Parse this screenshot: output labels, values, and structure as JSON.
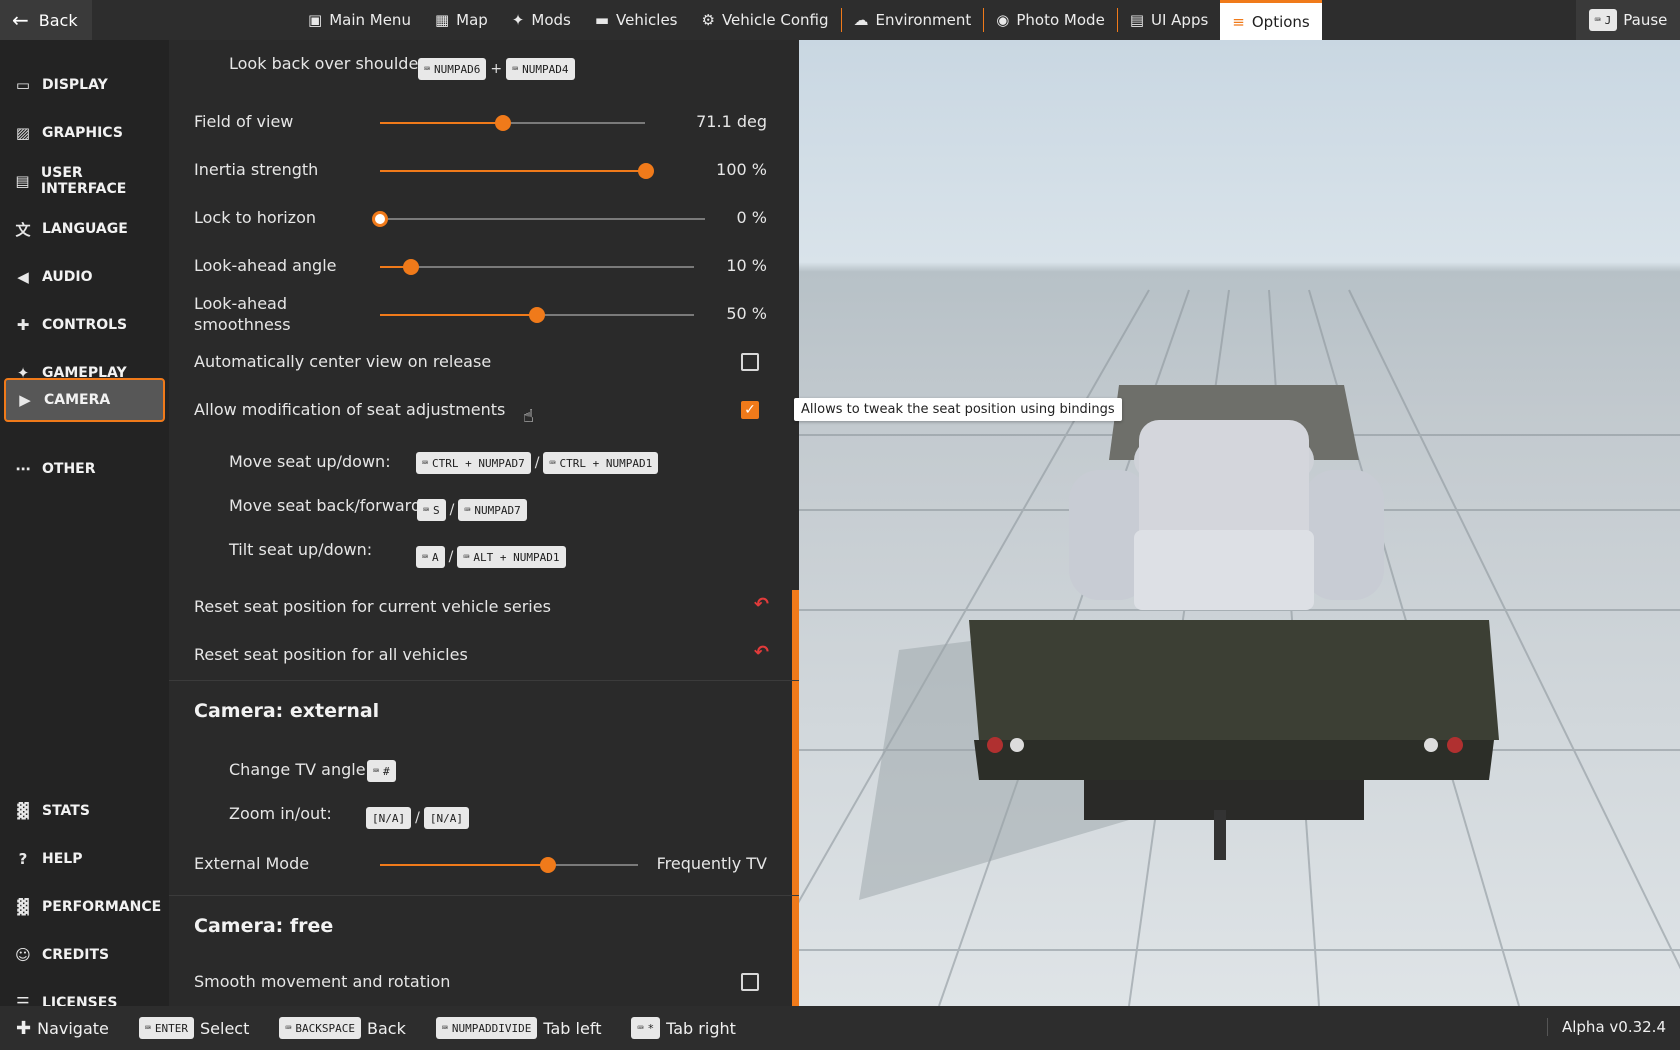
{
  "topbar": {
    "back_label": "Back",
    "tabs": [
      {
        "icon": "main-menu-icon",
        "label": "Main Menu"
      },
      {
        "icon": "map-icon",
        "label": "Map"
      },
      {
        "icon": "mods-icon",
        "label": "Mods"
      },
      {
        "icon": "car-icon",
        "label": "Vehicles"
      },
      {
        "icon": "engine-icon",
        "label": "Vehicle Config"
      },
      {
        "icon": "weather-icon",
        "label": "Environment"
      },
      {
        "icon": "camera-icon",
        "label": "Photo Mode"
      },
      {
        "icon": "apps-icon",
        "label": "UI Apps"
      },
      {
        "icon": "sliders-icon",
        "label": "Options"
      }
    ],
    "active_tab": "Options",
    "pause_key": "J",
    "pause_label": "Pause"
  },
  "sidebar": {
    "items": [
      {
        "icon": "monitor-icon",
        "label": "DISPLAY"
      },
      {
        "icon": "image-icon",
        "label": "GRAPHICS"
      },
      {
        "icon": "ui-icon",
        "label": "USER INTERFACE"
      },
      {
        "icon": "translate-icon",
        "label": "LANGUAGE"
      },
      {
        "icon": "speaker-icon",
        "label": "AUDIO"
      },
      {
        "icon": "gamepad-icon",
        "label": "CONTROLS"
      },
      {
        "icon": "puzzle-icon",
        "label": "GAMEPLAY"
      },
      {
        "icon": "video-camera-icon",
        "label": "CAMERA"
      },
      {
        "icon": "more-icon",
        "label": "OTHER"
      }
    ],
    "bottom_items": [
      {
        "icon": "bar-chart-icon",
        "label": "STATS"
      },
      {
        "icon": "help-icon",
        "label": "HELP"
      },
      {
        "icon": "performance-icon",
        "label": "PERFORMANCE"
      },
      {
        "icon": "people-icon",
        "label": "CREDITS"
      },
      {
        "icon": "license-icon",
        "label": "LICENSES"
      }
    ],
    "active": "CAMERA"
  },
  "settings": {
    "look_back": {
      "label": "Look back over shoulder:",
      "key1": "NUMPAD6",
      "joiner": "+",
      "key2": "NUMPAD4"
    },
    "fov": {
      "label": "Field of view",
      "value": "71.1 deg",
      "fraction": 0.466
    },
    "inertia": {
      "label": "Inertia strength",
      "value": "100 %",
      "fraction": 1.0
    },
    "lock_horizon": {
      "label": "Lock to horizon",
      "value": "0 %",
      "fraction": 0.0
    },
    "look_ahead_angle": {
      "label": "Look-ahead angle",
      "value": "10 %",
      "fraction": 0.1
    },
    "look_ahead_smooth": {
      "label": "Look-ahead smoothness",
      "value": "50 %",
      "fraction": 0.5
    },
    "auto_center": {
      "label": "Automatically center view on release",
      "checked": false
    },
    "seat_mod": {
      "label": "Allow modification of seat adjustments",
      "checked": true
    },
    "seat_updown": {
      "label": "Move seat up/down:",
      "key1": "CTRL + NUMPAD7",
      "sep": "/",
      "key2": "CTRL + NUMPAD1"
    },
    "seat_backfwd": {
      "label": "Move seat back/forward:",
      "key1": "S",
      "sep": "/",
      "key2": "NUMPAD7"
    },
    "seat_tilt": {
      "label": "Tilt seat up/down:",
      "key1": "A",
      "sep": "/",
      "key2": "ALT + NUMPAD1"
    },
    "reset_series": {
      "label": "Reset seat position for current vehicle series"
    },
    "reset_all": {
      "label": "Reset seat position for all vehicles"
    },
    "external_title": "Camera: external",
    "tv_angle": {
      "label": "Change TV angle:",
      "key1": "#"
    },
    "zoom": {
      "label": "Zoom in/out:",
      "key1": "[N/A]",
      "sep": "/",
      "key2": "[N/A]"
    },
    "external_mode": {
      "label": "External Mode",
      "value": "Frequently TV",
      "fraction": 0.65
    },
    "free_title": "Camera: free",
    "smooth_move": {
      "label": "Smooth movement and rotation",
      "checked": false
    }
  },
  "tooltip": "Allows to tweak the seat position using bindings",
  "bottombar": {
    "hints": [
      {
        "icon": "dpad-icon",
        "key": "",
        "label": "Navigate"
      },
      {
        "icon": "keyboard-icon",
        "key": "ENTER",
        "label": "Select"
      },
      {
        "icon": "keyboard-icon",
        "key": "BACKSPACE",
        "label": "Back"
      },
      {
        "icon": "keyboard-icon",
        "key": "NUMPADDIVIDE",
        "label": "Tab left"
      },
      {
        "icon": "keyboard-icon",
        "key": "*",
        "label": "Tab right"
      }
    ],
    "version": "Alpha v0.32.4"
  },
  "colors": {
    "accent": "#f07a1a",
    "panel": "#2a2a2a",
    "sidebar": "#232323",
    "reset": "#e23b3b"
  }
}
